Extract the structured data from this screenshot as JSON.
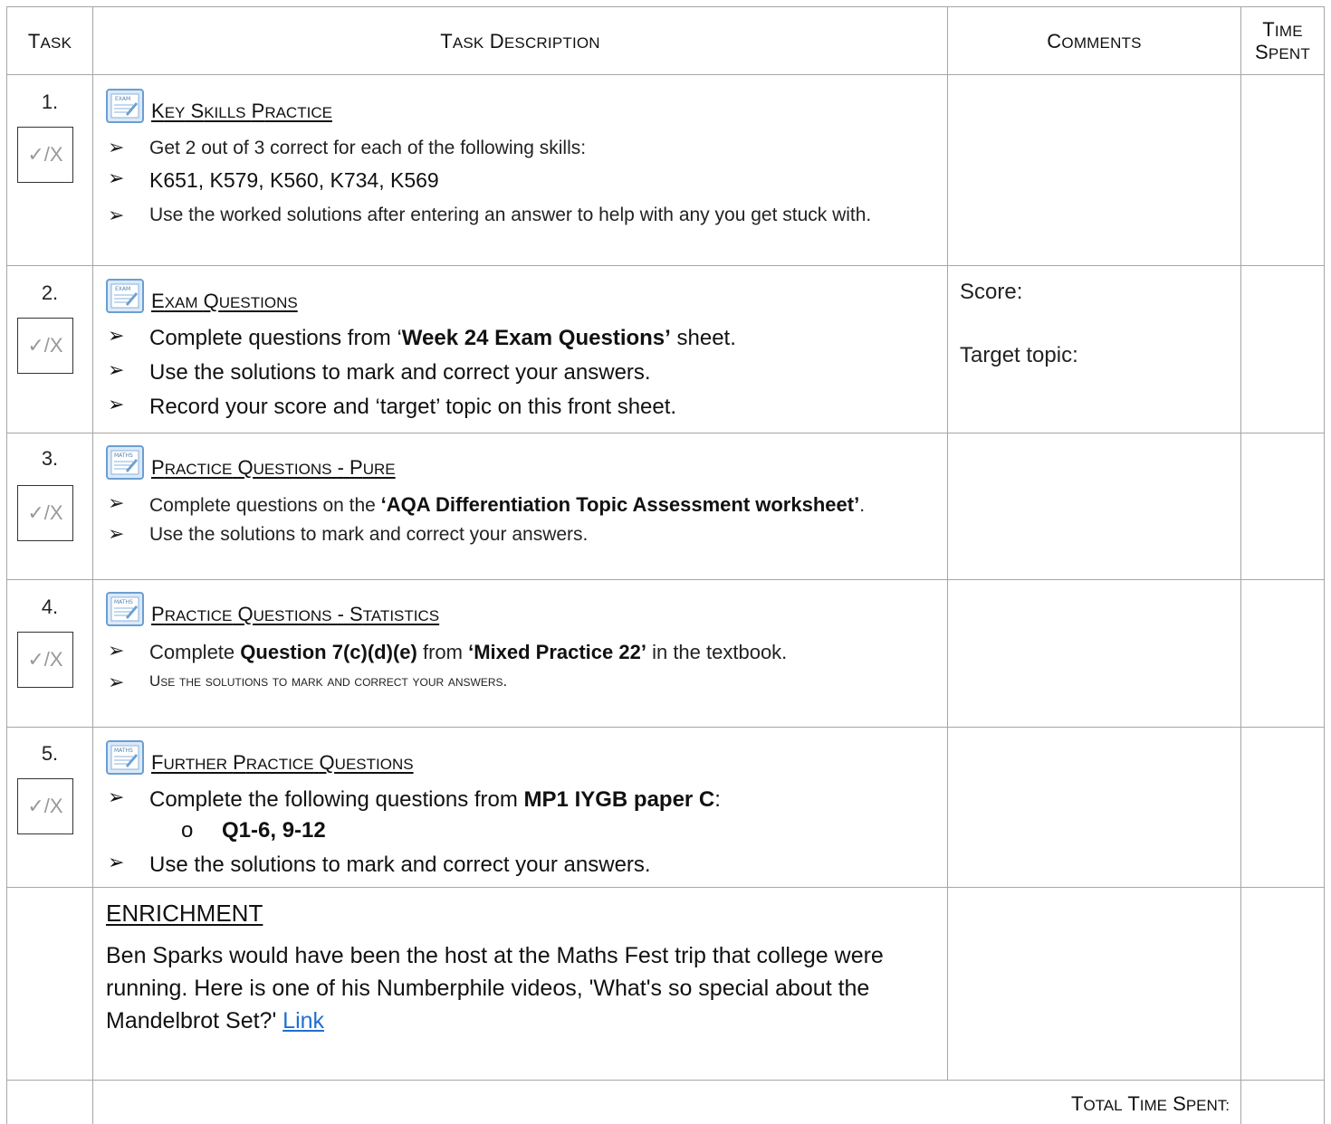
{
  "headers": {
    "task": "Task",
    "task_description": "Task Description",
    "comments": "Comments",
    "time_spent_line1": "Time",
    "time_spent_line2": "Spent"
  },
  "tick_label": "✓/X",
  "tasks": [
    {
      "number": "1.",
      "icon": "exam-icon",
      "title": "Key Skills Practice",
      "bullets": [
        {
          "text": "Get 2 out of 3 correct for each of the following skills:"
        },
        {
          "text": "K651, K579, K560, K734, K569"
        },
        {
          "text": "Use the worked solutions after entering an answer to help with any you get stuck with."
        }
      ]
    },
    {
      "number": "2.",
      "icon": "exam-icon",
      "title": "Exam Questions",
      "bullets": [
        {
          "pre": "Complete questions from ‘",
          "bold": "Week 24 Exam Questions’",
          "post": " sheet."
        },
        {
          "text": "Use the solutions to mark and correct your answers."
        },
        {
          "text": "Record your score and ‘target’ topic on this front sheet."
        }
      ],
      "comments": [
        "Score:",
        "Target topic:"
      ]
    },
    {
      "number": "3.",
      "icon": "maths-icon",
      "title": "Practice Questions - Pure",
      "bullets": [
        {
          "pre": "Complete questions on the ",
          "bold": "‘AQA Differentiation Topic Assessment worksheet’",
          "post": "."
        },
        {
          "text": "Use the solutions to mark and correct your answers."
        }
      ]
    },
    {
      "number": "4.",
      "icon": "maths-icon",
      "title": "Practice Questions - Statistics",
      "bullets": [
        {
          "pre": "Complete ",
          "bold": "Question 7(c)(d)(e)",
          "mid": " from ",
          "bold2": "‘Mixed Practice 22’",
          "post": " in the textbook."
        },
        {
          "text": "Use the solutions to mark and correct your answers."
        }
      ]
    },
    {
      "number": "5.",
      "icon": "maths-icon",
      "title": "Further Practice Questions",
      "bullets": [
        {
          "pre": "Complete the following questions from ",
          "bold": "MP1 IYGB paper C",
          "post": ":"
        },
        {
          "text": "Use the solutions to mark and correct your answers."
        }
      ],
      "sub_bullet": {
        "marker": "o",
        "text": "Q1-6, 9-12"
      }
    }
  ],
  "enrichment": {
    "title": "ENRICHMENT",
    "text": "Ben Sparks would have been the host at the Maths Fest trip that college were running.  Here is one of his Numberphile videos, 'What's so special about the Mandelbrot Set?' ",
    "link_text": "Link"
  },
  "total_label": "Total Time Spent:"
}
